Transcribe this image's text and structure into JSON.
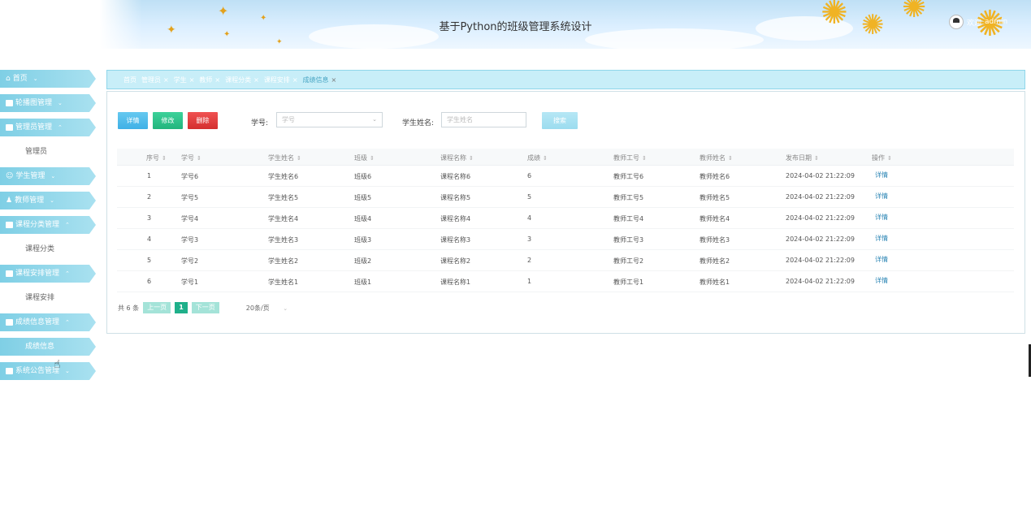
{
  "header": {
    "title": "基于Python的班级管理系统设计",
    "user_name": "admin",
    "user_prefix": "欢迎"
  },
  "sidebar": {
    "items": [
      {
        "label": "首页",
        "icon": "home-icon",
        "chevron": "⌄"
      },
      {
        "label": "轮播图管理",
        "icon": "grid-icon",
        "chevron": "⌄"
      },
      {
        "label": "管理员管理",
        "icon": "grid-icon",
        "chevron": "⌃"
      },
      {
        "label": "管理员",
        "sub": true
      },
      {
        "label": "学生管理",
        "icon": "user-icon",
        "chevron": "⌄"
      },
      {
        "label": "教师管理",
        "icon": "user-icon",
        "chevron": "⌄"
      },
      {
        "label": "课程分类管理",
        "icon": "grid-icon",
        "chevron": "⌃"
      },
      {
        "label": "课程分类",
        "sub": true
      },
      {
        "label": "课程安排管理",
        "icon": "grid-icon",
        "chevron": "⌃"
      },
      {
        "label": "课程安排",
        "sub": true
      },
      {
        "label": "成绩信息管理",
        "icon": "doc-icon",
        "chevron": "⌃"
      },
      {
        "label": "成绩信息",
        "sub": true,
        "active": true
      },
      {
        "label": "系统公告管理",
        "icon": "grid-icon",
        "chevron": "⌄"
      }
    ]
  },
  "tabs": [
    {
      "label": "首页"
    },
    {
      "label": "管理员"
    },
    {
      "label": "学生"
    },
    {
      "label": "教师"
    },
    {
      "label": "课程分类"
    },
    {
      "label": "课程安排"
    },
    {
      "label": "成绩信息",
      "active": true
    }
  ],
  "toolbar": {
    "detail_label": "详情",
    "edit_label": "修改",
    "delete_label": "删除",
    "student_no_label": "学号:",
    "student_no_placeholder": "学号",
    "student_name_label": "学生姓名:",
    "student_name_placeholder": "学生姓名",
    "search_label": "搜索"
  },
  "table": {
    "columns": [
      "序号",
      "学号",
      "学生姓名",
      "班级",
      "课程名称",
      "成绩",
      "教师工号",
      "教师姓名",
      "发布日期",
      "操作"
    ],
    "rows": [
      [
        "1",
        "学号6",
        "学生姓名6",
        "班级6",
        "课程名称6",
        "6",
        "教师工号6",
        "教师姓名6",
        "2024-04-02 21:22:09",
        "详情"
      ],
      [
        "2",
        "学号5",
        "学生姓名5",
        "班级5",
        "课程名称5",
        "5",
        "教师工号5",
        "教师姓名5",
        "2024-04-02 21:22:09",
        "详情"
      ],
      [
        "3",
        "学号4",
        "学生姓名4",
        "班级4",
        "课程名称4",
        "4",
        "教师工号4",
        "教师姓名4",
        "2024-04-02 21:22:09",
        "详情"
      ],
      [
        "4",
        "学号3",
        "学生姓名3",
        "班级3",
        "课程名称3",
        "3",
        "教师工号3",
        "教师姓名3",
        "2024-04-02 21:22:09",
        "详情"
      ],
      [
        "5",
        "学号2",
        "学生姓名2",
        "班级2",
        "课程名称2",
        "2",
        "教师工号2",
        "教师姓名2",
        "2024-04-02 21:22:09",
        "详情"
      ],
      [
        "6",
        "学号1",
        "学生姓名1",
        "班级1",
        "课程名称1",
        "1",
        "教师工号1",
        "教师姓名1",
        "2024-04-02 21:22:09",
        "详情"
      ]
    ]
  },
  "pager": {
    "total": "共 6 条",
    "prev": "上一页",
    "current": "1",
    "next": "下一页",
    "page_size": "20条/页"
  },
  "colors": {
    "accent": "#7fcfe5",
    "detail": "#3fb0e6",
    "edit": "#22b57d",
    "delete": "#d42f2f",
    "link": "#2a84b4"
  }
}
